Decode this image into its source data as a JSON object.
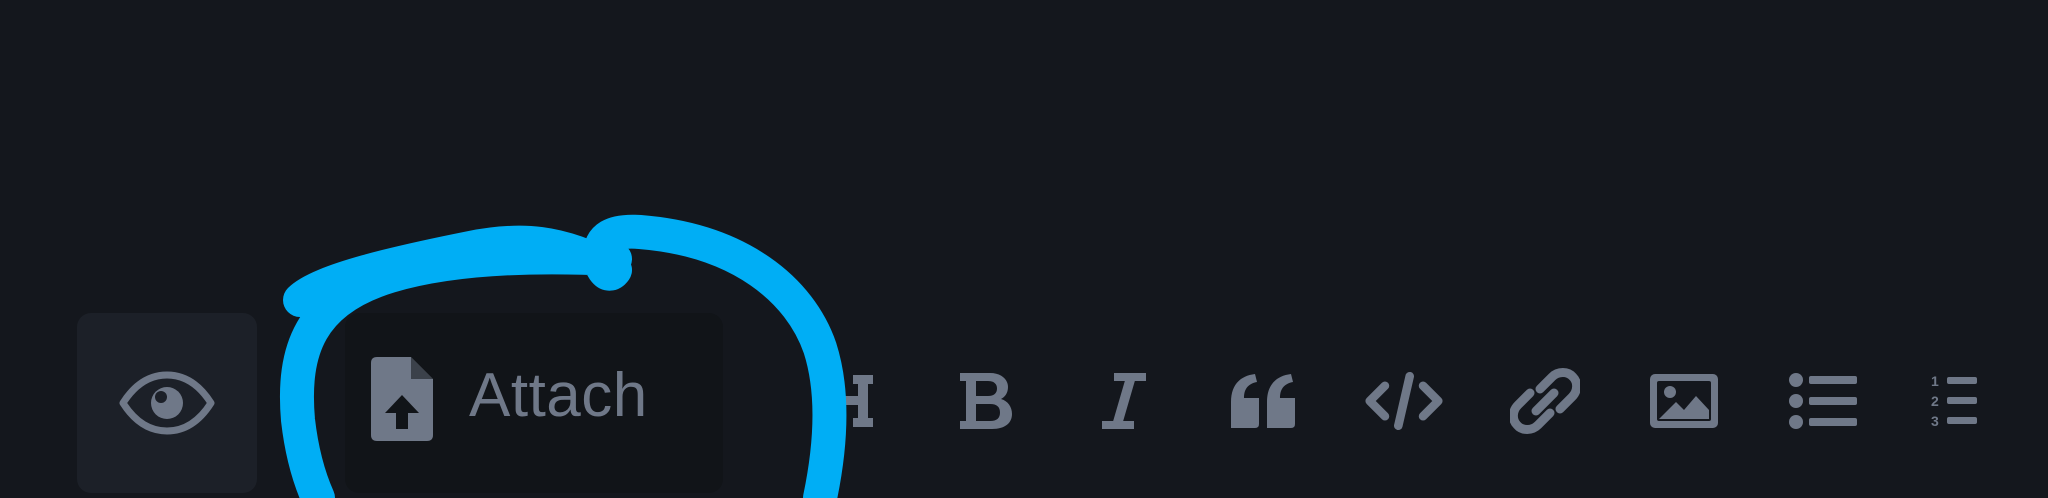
{
  "toolbar": {
    "attach_label": "Attach",
    "numbered_list_digits": [
      "1",
      "2",
      "3"
    ]
  },
  "icons": {
    "preview": "eye-icon",
    "attach": "file-upload-icon",
    "heading": "heading-icon",
    "bold": "bold-icon",
    "italic": "italic-icon",
    "quote": "quote-icon",
    "code": "code-icon",
    "link": "link-icon",
    "image": "image-icon",
    "bullet_list": "bullet-list-icon",
    "numbered_list": "numbered-list-icon"
  },
  "colors": {
    "background": "#14171d",
    "button_bg": "#1c2028",
    "icon": "#6f7888",
    "annotation": "#00aef5"
  }
}
